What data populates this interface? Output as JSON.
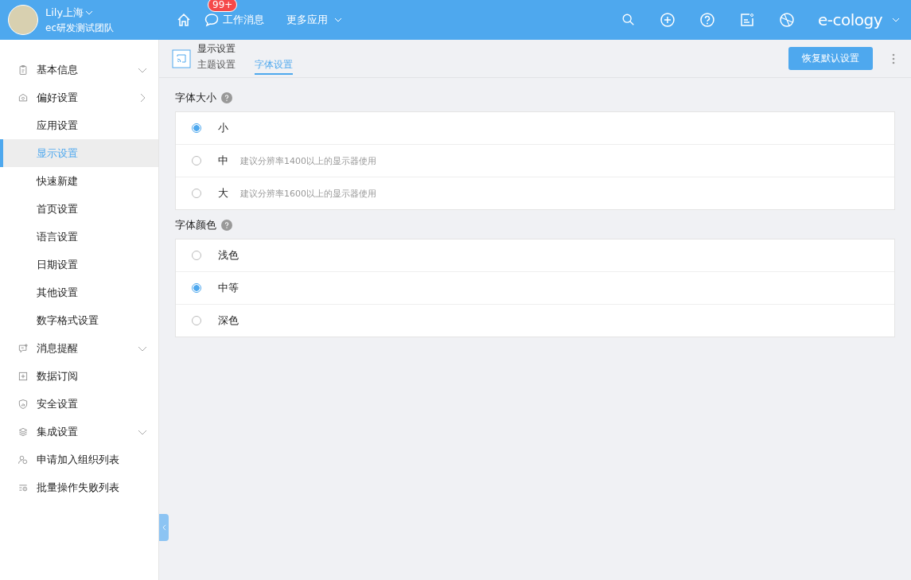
{
  "user": {
    "name": "Lily上海",
    "team": "ec研发测试团队"
  },
  "topnav": {
    "messages": {
      "label": "工作消息",
      "badge": "99+"
    },
    "more": {
      "label": "更多应用"
    },
    "brand": "e-cology"
  },
  "sidebar": {
    "items": [
      {
        "label": "基本信息",
        "expanded": false,
        "selected": false
      },
      {
        "label": "偏好设置",
        "expanded": true,
        "selected": false,
        "children": [
          {
            "label": "应用设置",
            "selected": false
          },
          {
            "label": "显示设置",
            "selected": true
          },
          {
            "label": "快速新建",
            "selected": false
          },
          {
            "label": "首页设置",
            "selected": false
          },
          {
            "label": "语言设置",
            "selected": false
          },
          {
            "label": "日期设置",
            "selected": false
          },
          {
            "label": "其他设置",
            "selected": false
          },
          {
            "label": "数字格式设置",
            "selected": false
          }
        ]
      },
      {
        "label": "消息提醒",
        "expanded": false,
        "selected": false
      },
      {
        "label": "数据订阅",
        "selected": false
      },
      {
        "label": "安全设置",
        "selected": false
      },
      {
        "label": "集成设置",
        "expanded": false,
        "selected": false
      },
      {
        "label": "申请加入组织列表",
        "selected": false
      },
      {
        "label": "批量操作失败列表",
        "selected": false
      }
    ]
  },
  "page": {
    "title": "显示设置",
    "tabs": [
      {
        "label": "主题设置",
        "selected": false
      },
      {
        "label": "字体设置",
        "selected": true
      }
    ],
    "reset_button": "恢复默认设置"
  },
  "sections": [
    {
      "title": "字体大小",
      "options": [
        {
          "label": "小",
          "selected": true
        },
        {
          "label": "中",
          "hint": "建议分辨率1400以上的显示器使用",
          "selected": false
        },
        {
          "label": "大",
          "hint": "建议分辨率1600以上的显示器使用",
          "selected": false
        }
      ]
    },
    {
      "title": "字体颜色",
      "options": [
        {
          "label": "浅色",
          "selected": false
        },
        {
          "label": "中等",
          "selected": true
        },
        {
          "label": "深色",
          "selected": false
        }
      ]
    }
  ]
}
